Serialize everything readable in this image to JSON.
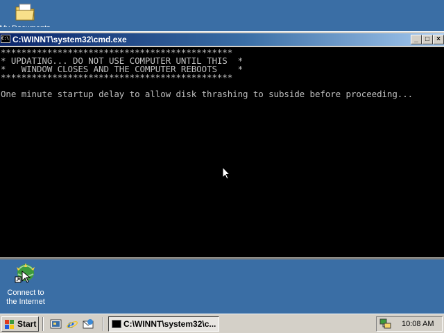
{
  "desktop": {
    "icons": [
      {
        "label": "My Documents",
        "icon": "folder-icon"
      },
      {
        "label": "Connect to the Internet",
        "label_line1": "Connect to",
        "label_line2": "the Internet",
        "icon": "connect-wizard-icon"
      }
    ]
  },
  "window": {
    "title": "C:\\WINNT\\system32\\cmd.exe",
    "buttons": {
      "minimize": "_",
      "maximize": "□",
      "close": "×"
    }
  },
  "console": {
    "lines": [
      "*********************************************",
      "* UPDATING... DO NOT USE COMPUTER UNTIL THIS  *",
      "*   WINDOW CLOSES AND THE COMPUTER REBOOTS    *",
      "*********************************************",
      "One minute startup delay to allow disk thrashing to subside before proceeding..."
    ],
    "colors": {
      "background": "#000000",
      "text": "#c0c0c0"
    }
  },
  "taskbar": {
    "start_label": "Start",
    "quick_launch": [
      "show-desktop-icon",
      "internet-explorer-icon",
      "outlook-express-icon"
    ],
    "tasks": [
      {
        "label": "C:\\WINNT\\system32\\c...",
        "icon": "cmd-icon"
      }
    ],
    "tray": {
      "clock": "10:08 AM",
      "icons": [
        "network-icon"
      ]
    }
  },
  "colors": {
    "desktop": "#3a6ea5",
    "titlebar_start": "#0a246a",
    "titlebar_end": "#a6caf0",
    "chrome": "#d4d0c8"
  }
}
